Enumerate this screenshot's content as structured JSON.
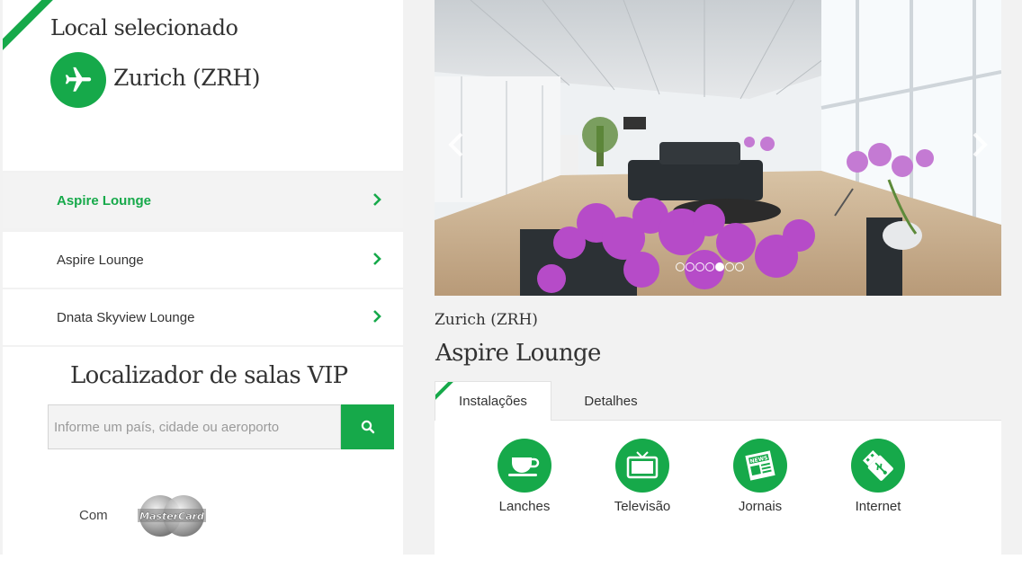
{
  "colors": {
    "accent": "#16a94a",
    "panel_bg": "#f2f2f2",
    "text": "#333333"
  },
  "selected": {
    "heading": "Local selecionado",
    "city": "Zurich (ZRH)",
    "icon": "plane-icon"
  },
  "lounges": [
    {
      "label": "Aspire Lounge",
      "active": true
    },
    {
      "label": "Aspire Lounge",
      "active": false
    },
    {
      "label": "Dnata Skyview Lounge",
      "active": false
    }
  ],
  "locator": {
    "heading": "Localizador de salas VIP",
    "placeholder": "Informe um país, cidade ou aeroporto",
    "value": "",
    "search_icon": "search-icon",
    "partner_prefix": "Com",
    "partner_logo": "MasterCard"
  },
  "carousel": {
    "total_slides": 7,
    "active_slide": 5
  },
  "detail": {
    "city": "Zurich (ZRH)",
    "lounge": "Aspire Lounge",
    "tabs": [
      {
        "label": "Instalações",
        "active": true
      },
      {
        "label": "Detalhes",
        "active": false
      }
    ],
    "amenities": [
      {
        "label": "Lanches",
        "icon": "coffee-cup-icon"
      },
      {
        "label": "Televisão",
        "icon": "television-icon"
      },
      {
        "label": "Jornais",
        "icon": "newspaper-icon"
      },
      {
        "label": "Internet",
        "icon": "usb-icon"
      }
    ]
  }
}
